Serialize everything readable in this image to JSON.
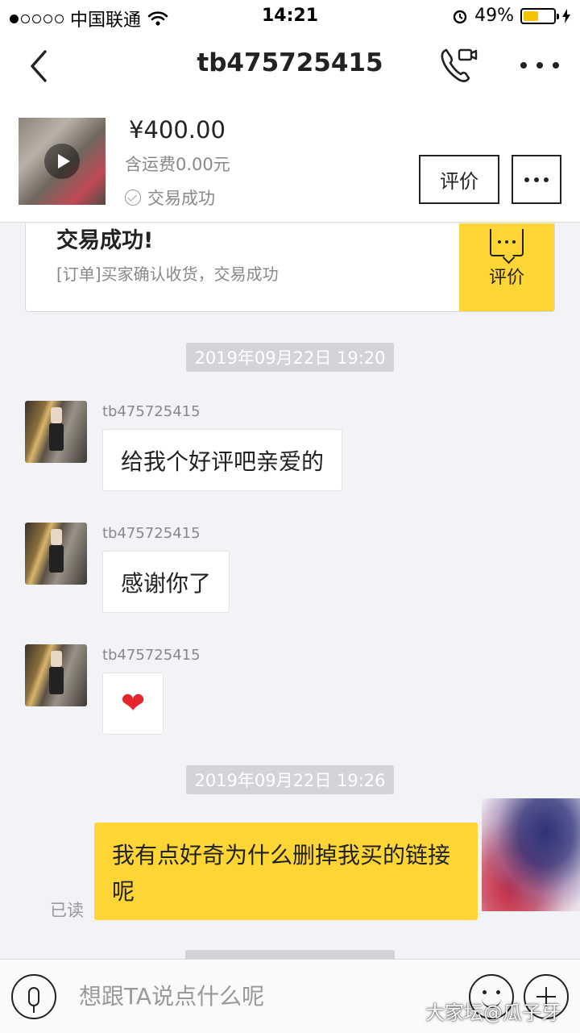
{
  "status_bar": {
    "carrier": "中国联通",
    "time": "14:21",
    "battery": "49%",
    "battery_level": 0.49
  },
  "nav": {
    "title": "tb475725415",
    "back_icon": "chevron-left-icon",
    "call_icon": "phone-video-icon",
    "more_icon": "more-dots-icon"
  },
  "product": {
    "price": "¥400.00",
    "shipping": "含运费0.00元",
    "status": "交易成功",
    "review_button": "评价"
  },
  "order_card": {
    "title": "交易成功!",
    "description": "[订单]买家确认收货，交易成功",
    "action_label": "评价"
  },
  "messages": {
    "timestamp_1": "2019年09月22日 19:20",
    "sender": "tb475725415",
    "msg_1": "给我个好评吧亲爱的",
    "msg_2": "感谢你了",
    "msg_3": "❤",
    "timestamp_2": "2019年09月22日 19:26",
    "read_status": "已读",
    "out_msg": "我有点好奇为什么删掉我买的链接呢"
  },
  "input": {
    "placeholder": "想跟TA说点什么呢"
  },
  "watermark": "大家坛@瓜子牙",
  "colors": {
    "accent_yellow": "#fdd535",
    "background": "#f2f3f7"
  }
}
